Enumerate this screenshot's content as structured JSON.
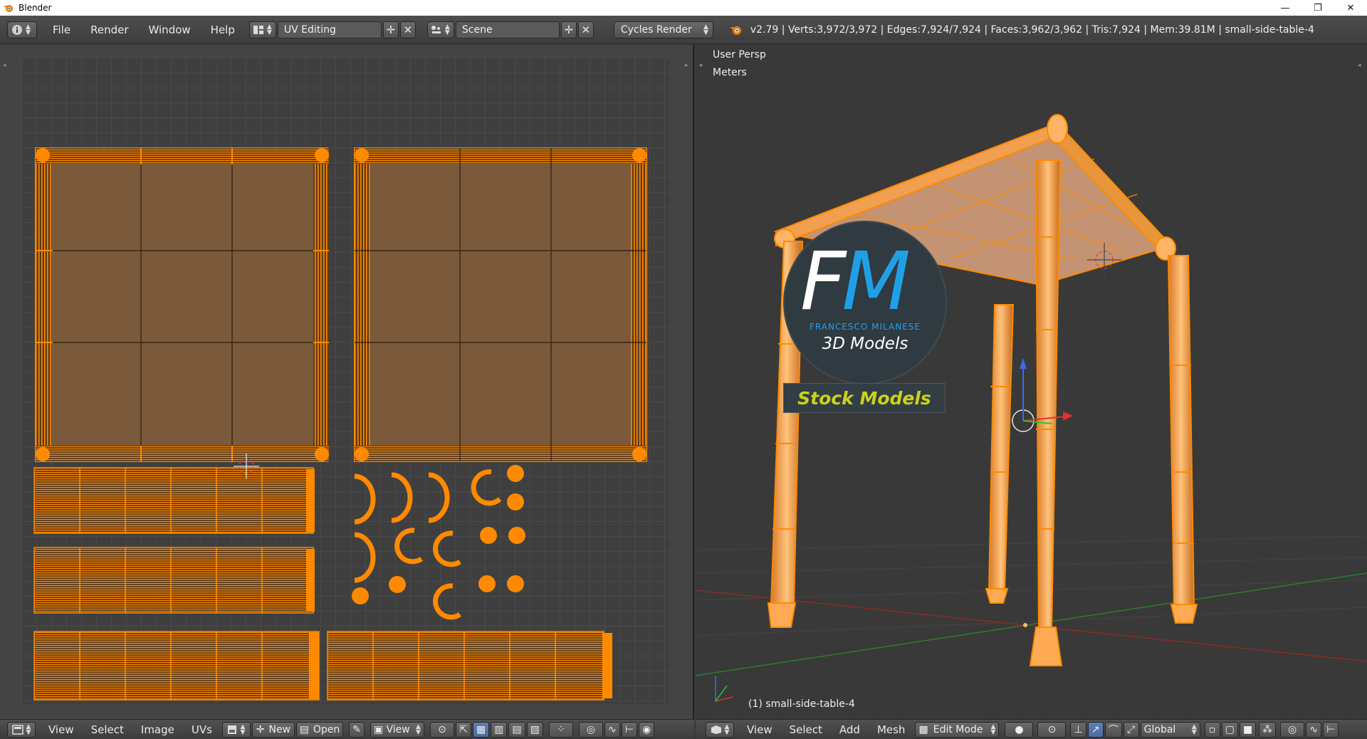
{
  "window": {
    "title": "Blender",
    "minimize": "—",
    "restore": "❐",
    "close": "✕"
  },
  "header": {
    "menus": [
      "File",
      "Render",
      "Window",
      "Help"
    ],
    "screen_layout": "UV Editing",
    "scene": "Scene",
    "render_engine": "Cycles Render",
    "stats": "v2.79 | Verts:3,972/3,972 | Edges:7,924/7,924 | Faces:3,962/3,962 | Tris:7,924 | Mem:39.81M | small-side-table-4",
    "add_glyph": "✛",
    "remove_glyph": "✕"
  },
  "viewport": {
    "view_name": "User Persp",
    "units": "Meters",
    "object_label": "(1) small-side-table-4"
  },
  "logo": {
    "letter_f": "F",
    "letter_m": "M",
    "name": "FRANCESCO MILANESE",
    "subtitle": "3D Models",
    "banner": "Stock Models"
  },
  "uv_footer": {
    "menus": [
      "View",
      "Select",
      "Image",
      "UVs"
    ],
    "new_label": "New",
    "open_label": "Open",
    "view_label": "View"
  },
  "view_footer": {
    "menus": [
      "View",
      "Select",
      "Add",
      "Mesh"
    ],
    "mode": "Edit Mode",
    "orientation": "Global"
  },
  "colors": {
    "uv_orange": "#ff8a00",
    "island_fill": "#7a5a3a",
    "accent_blue": "#1fa0e6",
    "banner_yellow": "#c8d21d"
  }
}
